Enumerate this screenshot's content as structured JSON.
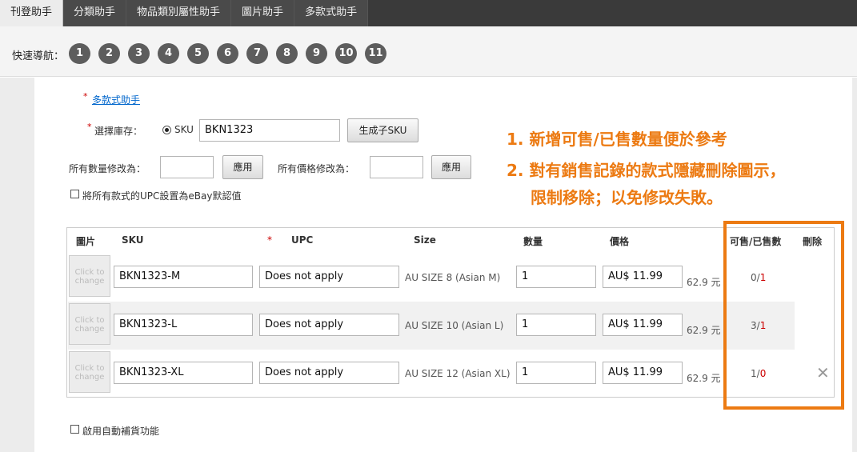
{
  "tabs": [
    {
      "label": "刊登助手",
      "active": true
    },
    {
      "label": "分類助手",
      "active": false
    },
    {
      "label": "物品類別屬性助手",
      "active": false
    },
    {
      "label": "圖片助手",
      "active": false
    },
    {
      "label": "多款式助手",
      "active": false
    }
  ],
  "quick_nav": {
    "label": "快速導航：",
    "items": [
      "1",
      "2",
      "3",
      "4",
      "5",
      "6",
      "7",
      "8",
      "9",
      "10",
      "11"
    ]
  },
  "form": {
    "multi_variation_link": "多款式助手",
    "select_stock_label": "選擇庫存：",
    "sku_radio_label": "SKU",
    "sku_value": "BKN1323",
    "generate_sku_button": "生成子SKU",
    "all_qty_label": "所有數量修改為：",
    "all_qty_value": "",
    "apply_qty_button": "應用",
    "all_price_label": "所有價格修改為：",
    "all_price_value": "",
    "apply_price_button": "應用",
    "upc_default_checkbox_label": "將所有款式的UPC設置為eBay默認值",
    "auto_restock_checkbox_label": "啟用自動補貨功能"
  },
  "annotation": {
    "line1": "1. 新增可售/已售數量便於參考",
    "line2": "2. 對有銷售記錄的款式隱藏刪除圖示，",
    "line3": "限制移除；以免修改失敗。",
    "color": "#ec7a12"
  },
  "table": {
    "headers": {
      "image": "圖片",
      "sku": "SKU",
      "upc_required_mark": "*",
      "upc": "UPC",
      "size": "Size",
      "quantity": "數量",
      "price": "價格",
      "available_sold": "可售/已售數",
      "delete": "刪除"
    },
    "image_placeholder": "Click to change",
    "rows": [
      {
        "sku": "BKN1323-M",
        "upc": "Does not apply",
        "size": "AU SIZE 8 (Asian M)",
        "quantity": "1",
        "price": "AU$ 11.99",
        "rmb": "62.9 元",
        "available": "0",
        "sold": "1",
        "deletable": false
      },
      {
        "sku": "BKN1323-L",
        "upc": "Does not apply",
        "size": "AU SIZE 10 (Asian L)",
        "quantity": "1",
        "price": "AU$ 11.99",
        "rmb": "62.9 元",
        "available": "3",
        "sold": "1",
        "deletable": false
      },
      {
        "sku": "BKN1323-XL",
        "upc": "Does not apply",
        "size": "AU SIZE 12 (Asian XL)",
        "quantity": "1",
        "price": "AU$ 11.99",
        "rmb": "62.9 元",
        "available": "1",
        "sold": "0",
        "deletable": true
      }
    ]
  }
}
